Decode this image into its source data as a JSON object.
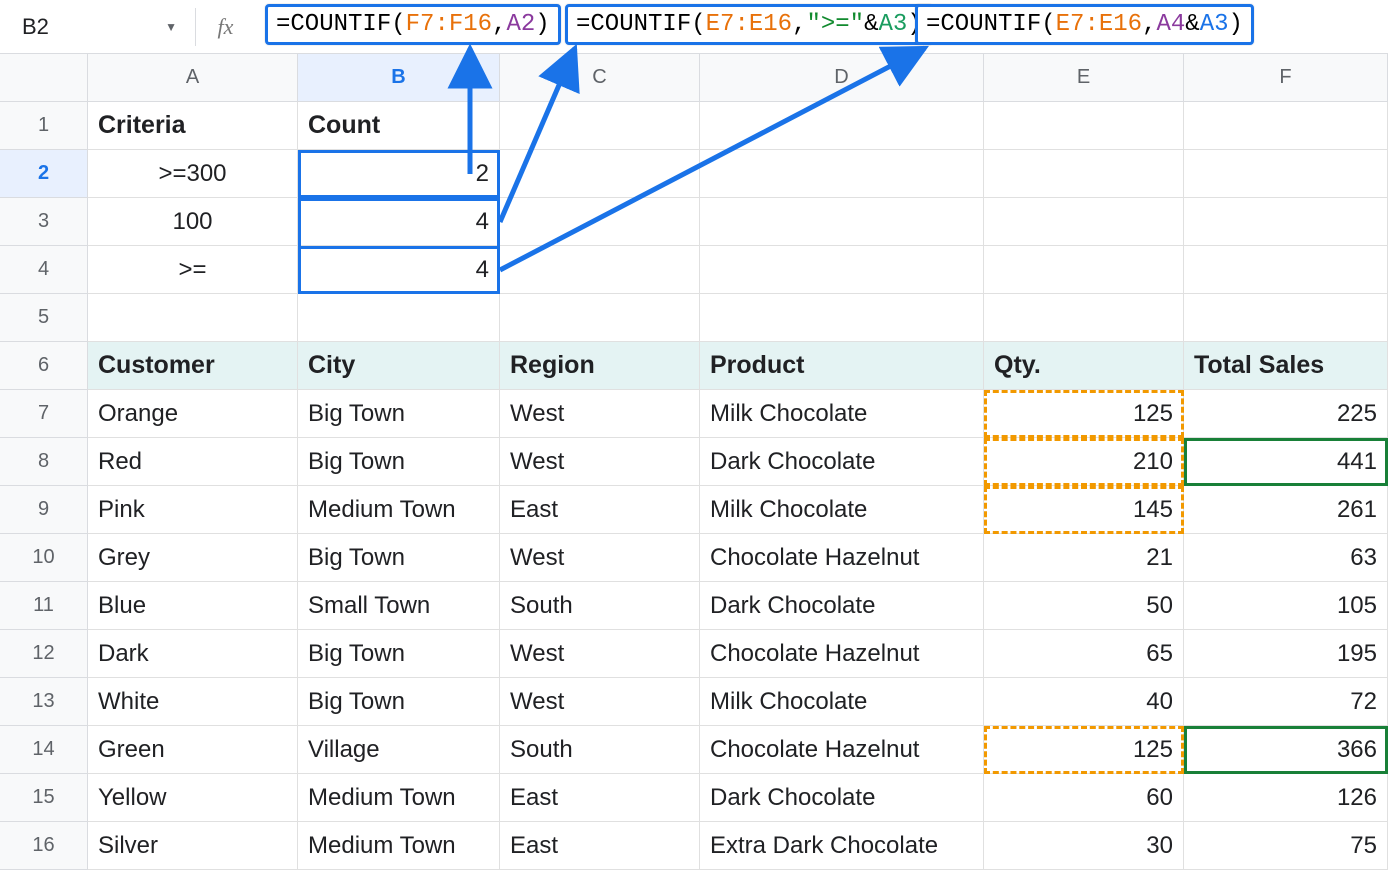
{
  "nameBox": {
    "ref": "B2"
  },
  "formulas": {
    "f1": {
      "range": "F7:F16",
      "arg": "A2"
    },
    "f2": {
      "range": "E7:E16",
      "str": "\">=\"",
      "arg": "A3"
    },
    "f3": {
      "range": "E7:E16",
      "arg1": "A4",
      "arg2": "A3"
    }
  },
  "columns": [
    "A",
    "B",
    "C",
    "D",
    "E",
    "F"
  ],
  "widths": [
    210,
    202,
    200,
    284,
    200,
    204
  ],
  "rowNumbers": [
    "1",
    "2",
    "3",
    "4",
    "5",
    "6",
    "7",
    "8",
    "9",
    "10",
    "11",
    "12",
    "13",
    "14",
    "15",
    "16"
  ],
  "labels": {
    "criteria": "Criteria",
    "count": "Count"
  },
  "criteria": [
    {
      "label": ">=300",
      "count": "2"
    },
    {
      "label": "100",
      "count": "4"
    },
    {
      "label": ">=",
      "count": "4"
    }
  ],
  "tableHeaders": {
    "customer": "Customer",
    "city": "City",
    "region": "Region",
    "product": "Product",
    "qty": "Qty.",
    "total": "Total Sales"
  },
  "tableRows": [
    {
      "customer": "Orange",
      "city": "Big Town",
      "region": "West",
      "product": "Milk Chocolate",
      "qty": "125",
      "total": "225"
    },
    {
      "customer": "Red",
      "city": "Big Town",
      "region": "West",
      "product": "Dark Chocolate",
      "qty": "210",
      "total": "441"
    },
    {
      "customer": "Pink",
      "city": "Medium Town",
      "region": "East",
      "product": "Milk Chocolate",
      "qty": "145",
      "total": "261"
    },
    {
      "customer": "Grey",
      "city": "Big Town",
      "region": "West",
      "product": "Chocolate Hazelnut",
      "qty": "21",
      "total": "63"
    },
    {
      "customer": "Blue",
      "city": "Small Town",
      "region": "South",
      "product": "Dark Chocolate",
      "qty": "50",
      "total": "105"
    },
    {
      "customer": "Dark",
      "city": "Big Town",
      "region": "West",
      "product": "Chocolate Hazelnut",
      "qty": "65",
      "total": "195"
    },
    {
      "customer": "White",
      "city": "Big Town",
      "region": "West",
      "product": "Milk Chocolate",
      "qty": "40",
      "total": "72"
    },
    {
      "customer": "Green",
      "city": "Village",
      "region": "South",
      "product": "Chocolate Hazelnut",
      "qty": "125",
      "total": "366"
    },
    {
      "customer": "Yellow",
      "city": "Medium Town",
      "region": "East",
      "product": "Dark Chocolate",
      "qty": "60",
      "total": "126"
    },
    {
      "customer": "Silver",
      "city": "Medium Town",
      "region": "East",
      "product": "Extra Dark Chocolate",
      "qty": "30",
      "total": "75"
    }
  ]
}
